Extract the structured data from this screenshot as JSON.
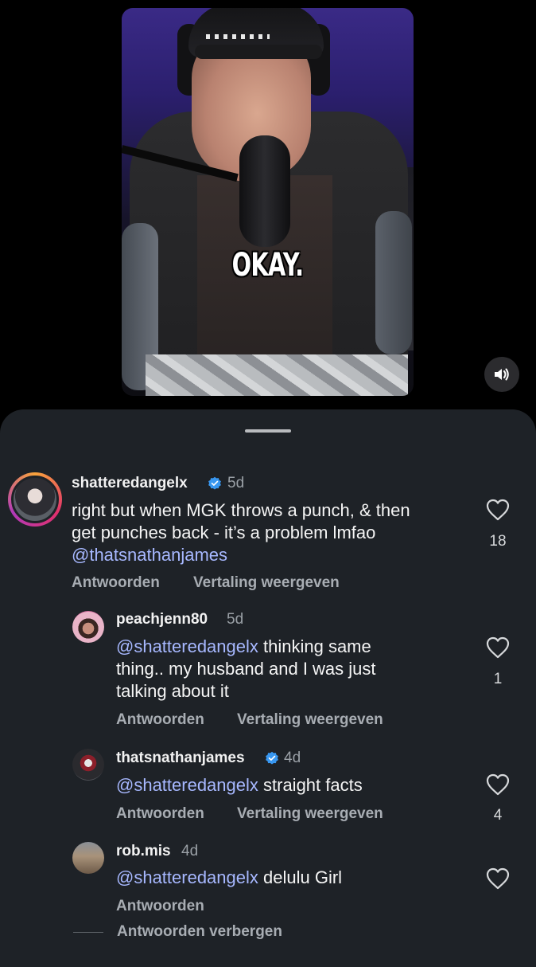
{
  "video": {
    "caption": "OKAY.",
    "mute_icon": "speaker-icon"
  },
  "comments": [
    {
      "username": "shatteredangelx",
      "verified": true,
      "time": "5d",
      "text_line1": "right but when MGK throws a punch, & then",
      "text_line2": "get punches back - it’s a problem lmfao",
      "mention": "@thatsnathanjames",
      "likes": "18",
      "reply_label": "Antwoorden",
      "translate_label": "Vertaling weergeven"
    },
    {
      "username": "peachjenn80",
      "verified": false,
      "time": "5d",
      "mention": "@shatteredangelx",
      "text_line1_rest": " thinking same",
      "text_line2": "thing.. my husband and I was just",
      "text_line3": "talking about it",
      "likes": "1",
      "reply_label": "Antwoorden",
      "translate_label": "Vertaling weergeven"
    },
    {
      "username": "thatsnathanjames",
      "verified": true,
      "time": "4d",
      "mention": "@shatteredangelx",
      "text_rest": " straight facts",
      "likes": "4",
      "reply_label": "Antwoorden",
      "translate_label": "Vertaling weergeven"
    },
    {
      "username": "rob.mis",
      "verified": false,
      "time": "4d",
      "mention": "@shatteredangelx",
      "text_rest": " delulu Girl",
      "likes": "",
      "reply_label": "Antwoorden"
    }
  ],
  "hide_replies_label": "Antwoorden verbergen",
  "colors": {
    "sheet_bg": "#1e2227",
    "mention": "#a7b8ff",
    "verified": "#3897f0"
  }
}
